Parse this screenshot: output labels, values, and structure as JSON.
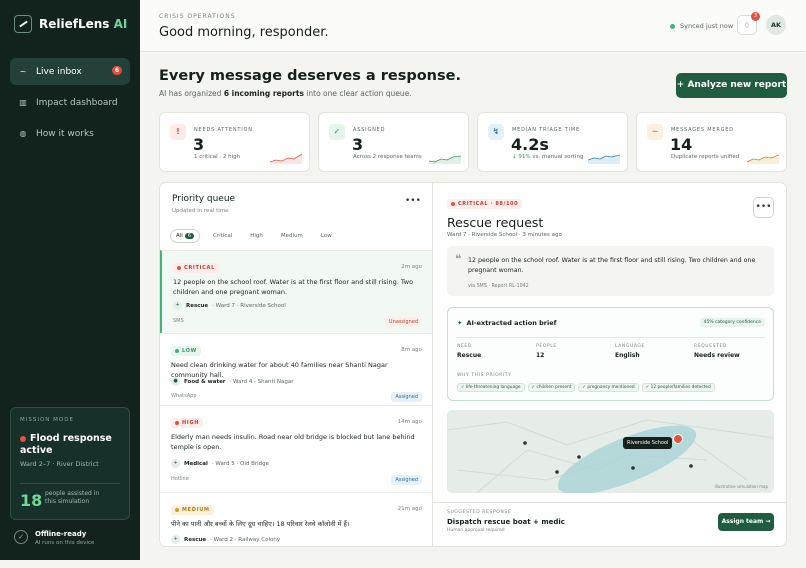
{
  "brand": {
    "name": "ReliefLens",
    "suffix": " AI"
  },
  "nav": [
    {
      "label": "Live inbox",
      "icon": "~",
      "badge": "6",
      "active": true
    },
    {
      "label": "Impact dashboard",
      "icon": "▥"
    },
    {
      "label": "How it works",
      "icon": "◍"
    }
  ],
  "mission": {
    "label": "MISSION MODE",
    "title": "Flood response active",
    "sub": "Ward 2–7 · River District",
    "count": "18",
    "count_label": "people assisted in this simulation"
  },
  "offline": {
    "title": "Offline-ready",
    "sub": "AI runs on this device"
  },
  "topbar": {
    "eyebrow": "CRISIS OPERATIONS",
    "greeting": "Good morning, responder.",
    "synced": "Synced just now",
    "bell_count": "3",
    "avatar": "AK"
  },
  "hero": {
    "title": "Every message deserves a response.",
    "sub_pre": "AI has organized ",
    "sub_bold": "6 incoming reports",
    "sub_post": " into one clear action queue.",
    "cta": "+ Analyze new report"
  },
  "stats": [
    {
      "label": "NEEDS ATTENTION",
      "value": "3",
      "sub": "1 critical · 2 high",
      "icon": "!",
      "color": "#e2533e",
      "bg": "#fdecea"
    },
    {
      "label": "ASSIGNED",
      "value": "3",
      "sub": "Across 2 response teams",
      "icon": "✓",
      "color": "#2f9a63",
      "bg": "#e6f4ec"
    },
    {
      "label": "MEDIAN TRIAGE TIME",
      "value": "4.2s",
      "sub_up": "↓ 91%",
      "sub": " vs. manual sorting",
      "icon": "↯",
      "color": "#2a7fb3",
      "bg": "#e4f0f8"
    },
    {
      "label": "MESSAGES MERGED",
      "value": "14",
      "sub": "Duplicate reports unified",
      "icon": "~",
      "color": "#c98a1a",
      "bg": "#fbf1de"
    }
  ],
  "queue": {
    "title": "Priority queue",
    "sub": "Updated in real time",
    "filters": [
      {
        "label": "All",
        "count": "6"
      },
      {
        "label": "Critical"
      },
      {
        "label": "High"
      },
      {
        "label": "Medium"
      },
      {
        "label": "Low"
      }
    ],
    "items": [
      {
        "tag": "CRITICAL",
        "time": "2m ago",
        "text": "12 people on the school roof. Water is at the first floor and still rising. Two children and one pregnant woman.",
        "category": "Rescue",
        "location": "· Ward 7 · Riverside School",
        "source": "SMS",
        "status": "Unassigned",
        "icon": "+"
      },
      {
        "tag": "LOW",
        "time": "8m ago",
        "text": "Need clean drinking water for about 40 families near Shanti Nagar community hall.",
        "category": "Food & water",
        "location": "· Ward 4 · Shanti Nagar",
        "source": "WhatsApp",
        "status": "Assigned",
        "icon": "●"
      },
      {
        "tag": "HIGH",
        "time": "14m ago",
        "text": "Elderly man needs insulin. Road near old bridge is blocked but lane behind temple is open.",
        "category": "Medical",
        "location": "· Ward 5 · Old Bridge",
        "source": "Hotline",
        "status": "Assigned",
        "icon": "+"
      },
      {
        "tag": "MEDIUM",
        "time": "21m ago",
        "text": "पीने का पानी और बच्चों के लिए दूध चाहिए। 18 परिवार रेलवे कॉलोनी में हैं।",
        "category": "Rescue",
        "location": "· Ward 2 · Railway Colony",
        "source": "",
        "status": "",
        "icon": "+"
      }
    ]
  },
  "detail": {
    "tag": "CRITICAL · 88/100",
    "title": "Rescue request",
    "sub": "Ward 7 · Riverside School · 3 minutes ago",
    "quote": "12 people on the school roof. Water is at the first floor and still rising. Two children and one pregnant woman.",
    "quote_src": "via SMS · Report RL-1042",
    "brief": {
      "title": "AI-extracted action brief",
      "confidence": "45% category confidence",
      "fields": [
        {
          "k": "NEED",
          "v": "Rescue"
        },
        {
          "k": "PEOPLE",
          "v": "12"
        },
        {
          "k": "LANGUAGE",
          "v": "English"
        },
        {
          "k": "REQUESTED",
          "v": "Needs review"
        }
      ],
      "why_label": "WHY THIS PRIORITY",
      "chips": [
        "✓ life-threatening language",
        "✓ children present",
        "✓ pregnancy mentioned",
        "✓ 12 people/families detected"
      ]
    },
    "map": {
      "label": "Riverside School",
      "note": "Illustrative simulation map"
    },
    "suggested": {
      "label": "SUGGESTED RESPONSE",
      "value": "Dispatch rescue boat + medic",
      "note": "Human approval required",
      "button": "Assign team →"
    }
  },
  "colors": {
    "sidebar": "#12231d",
    "accent": "#1f5c40",
    "critical": "#e2533e",
    "low": "#3fb57a",
    "high": "#e2533e",
    "medium": "#d99a1e"
  }
}
